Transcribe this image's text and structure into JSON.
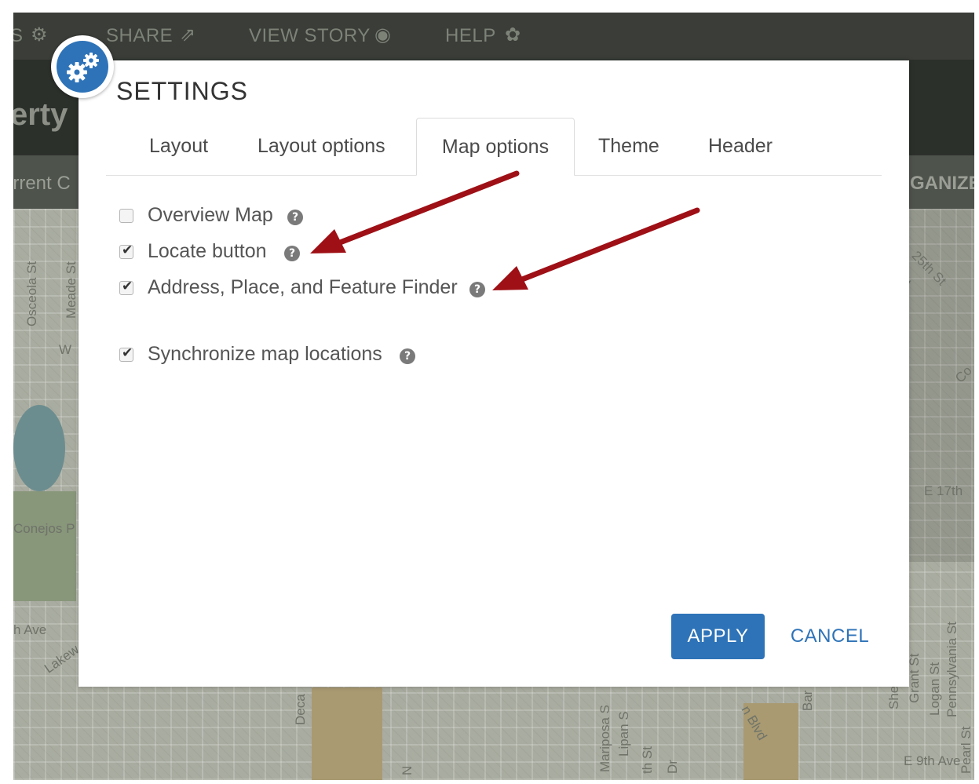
{
  "background": {
    "topbar": {
      "settings_fragment": "S",
      "share": "SHARE",
      "view_story": "VIEW STORY",
      "help": "HELP"
    },
    "title_fragment": "erty",
    "tab_fragment_left": "irrent C",
    "tab_fragment_right": "GANIZE",
    "streets": [
      "Osceola St",
      "Meade St",
      "W",
      "Conejos P",
      "h Ave",
      "Lakew",
      "25th St",
      "St",
      "Co",
      "E 17th",
      "E 9th Ave",
      "Mariposa S",
      "Lipan S",
      "Deca",
      "th St",
      "Dr",
      "Grant St",
      "Logan St",
      "Pennsylvania St",
      "Pearl St",
      "She",
      "Bar",
      "n Blvd",
      "N"
    ]
  },
  "dialog": {
    "title": "SETTINGS",
    "tabs": [
      {
        "label": "Layout",
        "active": false
      },
      {
        "label": "Layout options",
        "active": false
      },
      {
        "label": "Map options",
        "active": true
      },
      {
        "label": "Theme",
        "active": false
      },
      {
        "label": "Header",
        "active": false
      }
    ],
    "options": [
      {
        "label": "Overview Map",
        "checked": false
      },
      {
        "label": "Locate button",
        "checked": true
      },
      {
        "label": "Address, Place, and Feature Finder",
        "checked": true
      },
      {
        "label": "Synchronize map locations",
        "checked": true
      }
    ],
    "apply_label": "APPLY",
    "cancel_label": "CANCEL"
  },
  "icons": {
    "settings_badge": "gears-icon",
    "help": "question-circle-icon",
    "checkbox_check": "check-icon",
    "share": "share-icon",
    "view_story": "eye-icon",
    "help_nav": "lifebuoy-icon",
    "annotation": "arrow-icon"
  },
  "colors": {
    "accent": "#2e73b8",
    "annotation_arrow": "#9e1016",
    "dialog_bg": "#ffffff",
    "overlay_dark": "#2c302b"
  }
}
